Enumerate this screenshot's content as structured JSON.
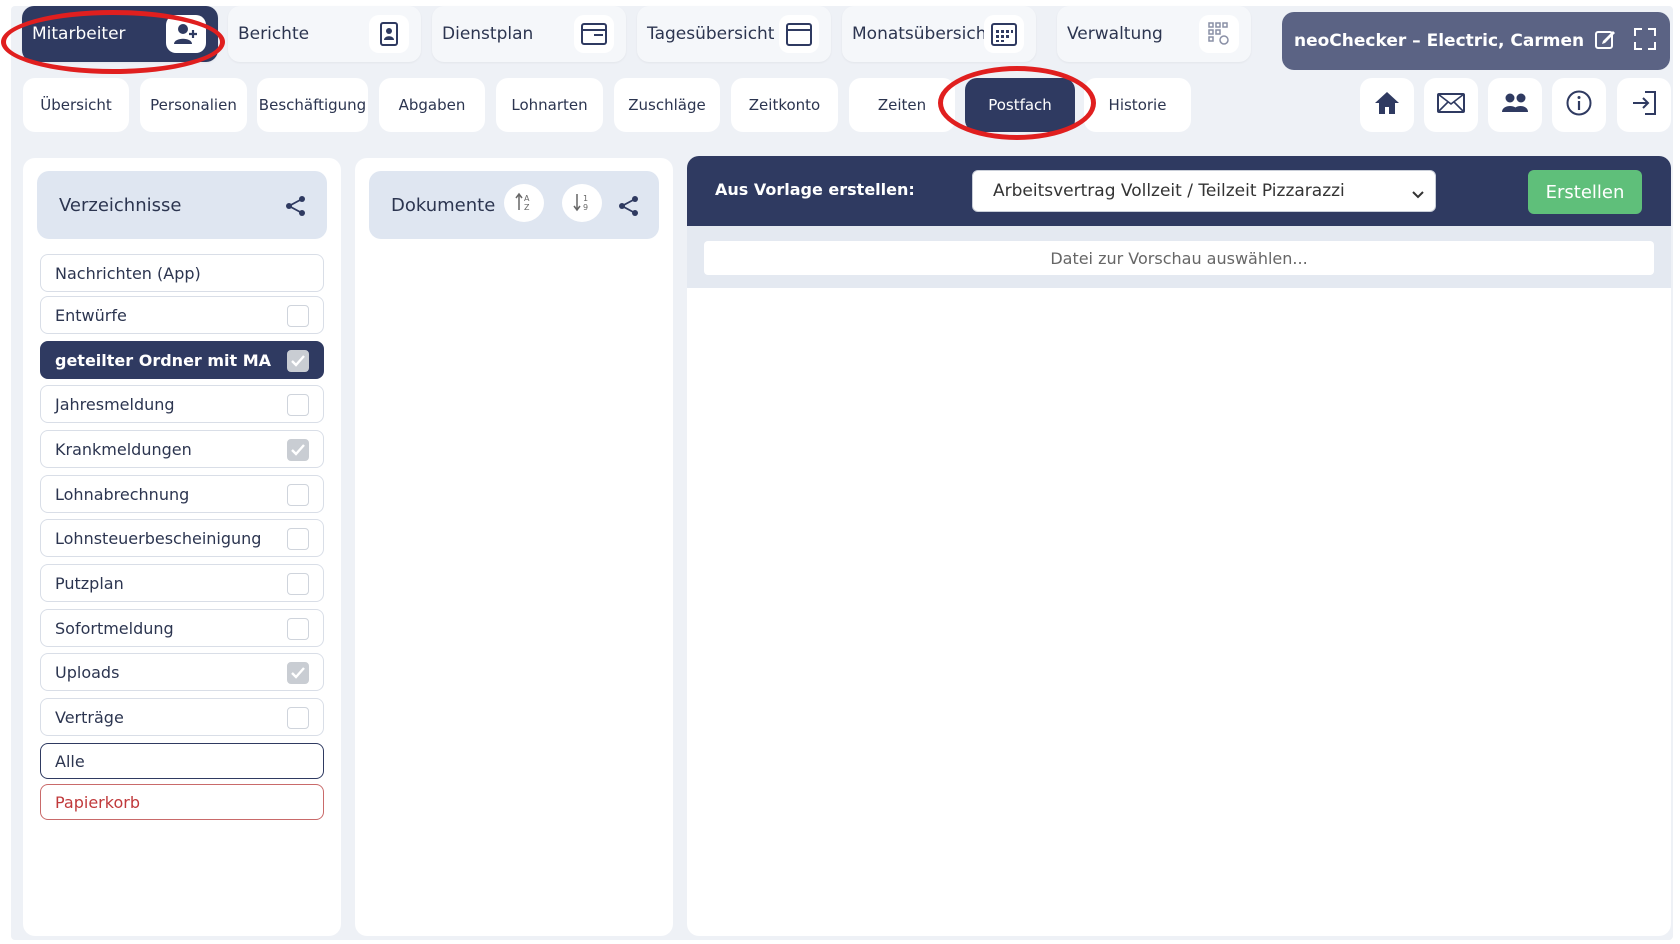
{
  "nav": {
    "tabs": [
      {
        "label": "Mitarbeiter",
        "icon": "user-plus-icon"
      },
      {
        "label": "Berichte",
        "icon": "report-icon"
      },
      {
        "label": "Dienstplan",
        "icon": "schedule-icon"
      },
      {
        "label": "Tagesübersicht",
        "icon": "day-calendar-icon"
      },
      {
        "label": "Monatsübersicht",
        "icon": "month-calendar-icon"
      },
      {
        "label": "Verwaltung",
        "icon": "admin-grid-icon"
      }
    ],
    "account": "neoChecker – Electric, Carmen"
  },
  "subnav": {
    "tabs": [
      "Übersicht",
      "Personalien",
      "Beschäftigung",
      "Abgaben",
      "Lohnarten",
      "Zuschläge",
      "Zeitkonto",
      "Zeiten",
      "Postfach",
      "Historie"
    ],
    "active": "Postfach"
  },
  "directories": {
    "title": "Verzeichnisse",
    "items": [
      {
        "label": "Nachrichten (App)",
        "checkbox": "none"
      },
      {
        "label": "Entwürfe",
        "checkbox": "unchecked"
      },
      {
        "label": "geteilter Ordner mit MA",
        "checkbox": "checked"
      },
      {
        "label": "Jahresmeldung",
        "checkbox": "unchecked"
      },
      {
        "label": "Krankmeldungen",
        "checkbox": "checked"
      },
      {
        "label": "Lohnabrechnung",
        "checkbox": "unchecked"
      },
      {
        "label": "Lohnsteuerbescheinigung",
        "checkbox": "unchecked"
      },
      {
        "label": "Putzplan",
        "checkbox": "unchecked"
      },
      {
        "label": "Sofortmeldung",
        "checkbox": "unchecked"
      },
      {
        "label": "Uploads",
        "checkbox": "checked"
      },
      {
        "label": "Verträge",
        "checkbox": "unchecked"
      },
      {
        "label": "Alle",
        "checkbox": "none"
      },
      {
        "label": "Papierkorb",
        "checkbox": "none"
      }
    ]
  },
  "documents": {
    "title": "Dokumente"
  },
  "preview": {
    "template_label": "Aus Vorlage erstellen:",
    "template_selected": "Arbeitsvertrag Vollzeit / Teilzeit Pizzarazzi",
    "create_label": "Erstellen",
    "file_hint": "Datei zur Vorschau auswählen..."
  },
  "colors": {
    "primary": "#2f3a61",
    "accent_green": "#5fbf7a",
    "danger": "#c0393b",
    "annotation": "#e01f1f"
  }
}
